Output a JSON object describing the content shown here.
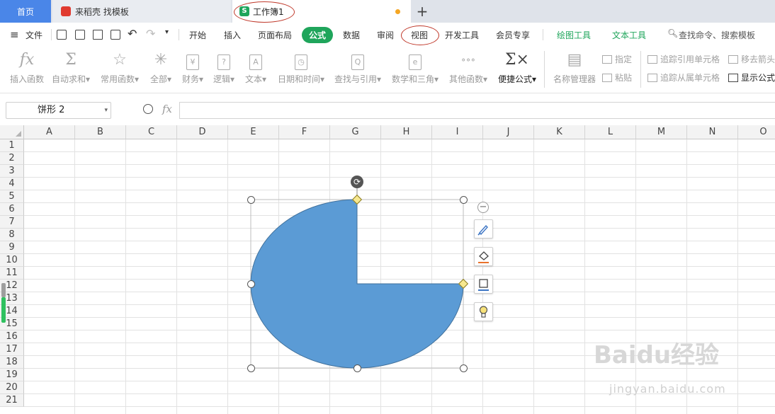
{
  "tabs": {
    "home": "首页",
    "doc": "来稻壳 找模板",
    "book": "工作簿1",
    "book_icon": "S",
    "add": "+"
  },
  "menu": {
    "file": "文件",
    "items": [
      "开始",
      "插入",
      "页面布局",
      "公式",
      "数据",
      "审阅",
      "视图",
      "开发工具",
      "会员专享"
    ],
    "active": "公式",
    "tools": [
      "绘图工具",
      "文本工具"
    ],
    "search": "查找命令、搜索模板"
  },
  "ribbon": {
    "buttons": [
      {
        "icon": "fx",
        "label": "插入函数"
      },
      {
        "icon": "Σ",
        "label": "自动求和▾"
      },
      {
        "icon": "☆",
        "label": "常用函数▾"
      },
      {
        "icon": "✳",
        "label": "全部▾"
      },
      {
        "icon": "¥",
        "label": "财务▾"
      },
      {
        "icon": "?",
        "label": "逻辑▾"
      },
      {
        "icon": "A",
        "label": "文本▾"
      },
      {
        "icon": "◷",
        "label": "日期和时间▾"
      },
      {
        "icon": "Q",
        "label": "查找与引用▾"
      },
      {
        "icon": "e",
        "label": "数学和三角▾"
      },
      {
        "icon": "∘∘∘",
        "label": "其他函数▾"
      },
      {
        "icon": "Σ×",
        "label": "便捷公式▾"
      },
      {
        "icon": "▤",
        "label": "名称管理器"
      }
    ],
    "small": {
      "assign": "指定",
      "paste": "粘贴",
      "trace_precedents": "追踪引用单元格",
      "trace_dependents": "追踪从属单元格",
      "remove_arrows": "移去箭头",
      "show_formulas": "显示公式"
    }
  },
  "formula_bar": {
    "name_box": "饼形 2",
    "fx": "fx",
    "value": ""
  },
  "grid": {
    "columns": [
      "A",
      "B",
      "C",
      "D",
      "E",
      "F",
      "G",
      "H",
      "I",
      "J",
      "K",
      "L",
      "M",
      "N",
      "O"
    ],
    "rows": [
      "1",
      "2",
      "3",
      "4",
      "5",
      "6",
      "7",
      "8",
      "9",
      "10",
      "11",
      "12",
      "13",
      "14",
      "15",
      "16",
      "17",
      "18",
      "19",
      "20",
      "21"
    ]
  },
  "shape": {
    "name": "饼形 2",
    "fill": "#5b9bd5",
    "stroke": "#41719c",
    "visible_fraction": 0.75
  },
  "side_tools": [
    "minus-icon",
    "brush-icon",
    "fill-icon",
    "outline-icon",
    "bulb-icon"
  ],
  "watermark": {
    "brand": "Baidu经验",
    "url": "jingyan.baidu.com"
  },
  "colors": {
    "accent_green": "#1fa55b",
    "home_tab": "#4a86e8",
    "annotation_red": "#c0392b"
  }
}
